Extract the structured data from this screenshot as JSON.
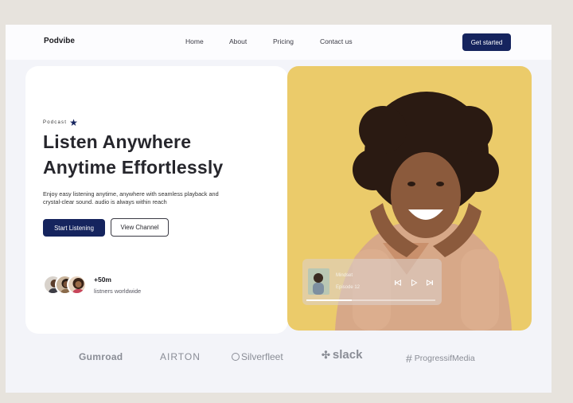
{
  "nav": {
    "brand": "Podvibe",
    "links": [
      "Home",
      "About",
      "Pricing",
      "Contact us"
    ],
    "cta": "Get started"
  },
  "hero": {
    "tag": "Podcast",
    "heading_line1": "Listen Anywhere",
    "heading_line2": "Anytime Effortlessly",
    "description": "Enjoy easy listening anytime, anywhere with seamless playback and crystal-clear sound.  audio is always within reach",
    "primary_button": "Start Listening",
    "secondary_button": "View Channel",
    "stat_value": "+50m",
    "stat_label": "listners worldwide"
  },
  "player": {
    "title": "Mindset",
    "episode": "Episode 12",
    "progress": 0.35,
    "controls": [
      "previous-icon",
      "play-icon",
      "next-icon"
    ]
  },
  "logos": [
    "Gumroad",
    "AIRTON",
    "Silverfleet",
    "slack",
    "ProgressifMedia"
  ],
  "colors": {
    "primary": "#15245e",
    "photo_background": "#ebcb6a",
    "page_background": "#f3f4f9"
  }
}
